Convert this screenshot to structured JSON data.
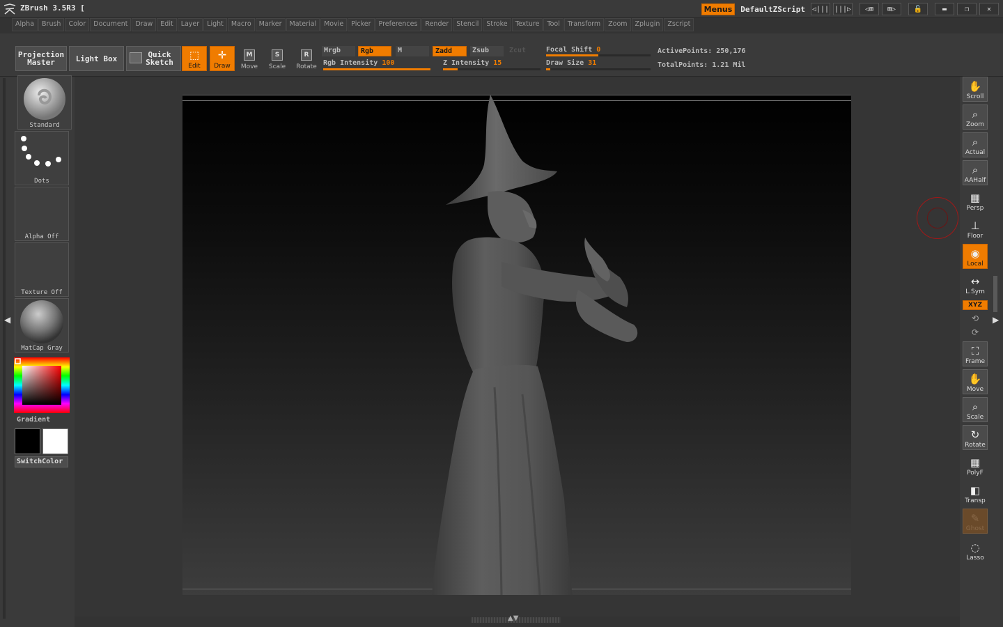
{
  "titlebar": {
    "app_title": "ZBrush 3.5R3 [",
    "menus_label": "Menus",
    "script_name": "DefaultZScript",
    "icons": [
      "step-back-icon",
      "step-forward-icon",
      "window-a-icon",
      "window-b-icon",
      "lock-icon",
      "minimize-icon",
      "restore-icon",
      "close-icon"
    ],
    "icon_glyphs": [
      "◁|||",
      "|||▷",
      "◁⊞",
      "⊞▷",
      "🔓",
      "▬",
      "❐",
      "✕"
    ]
  },
  "menubar": {
    "items": [
      "Alpha",
      "Brush",
      "Color",
      "Document",
      "Draw",
      "Edit",
      "Layer",
      "Light",
      "Macro",
      "Marker",
      "Material",
      "Movie",
      "Picker",
      "Preferences",
      "Render",
      "Stencil",
      "Stroke",
      "Texture",
      "Tool",
      "Transform",
      "Zoom",
      "Zplugin",
      "Zscript"
    ]
  },
  "shelf": {
    "projection_master": "Projection Master",
    "light_box": "Light Box",
    "quick_sketch": "Quick Sketch",
    "tools": {
      "edit": "Edit",
      "draw": "Draw",
      "move": "Move",
      "scale": "Scale",
      "rotate": "Rotate"
    },
    "modes": {
      "mrgb": "Mrgb",
      "rgb": "Rgb",
      "m": "M",
      "zadd": "Zadd",
      "zsub": "Zsub",
      "zcut": "Zcut"
    },
    "rgb_intensity": {
      "label": "Rgb Intensity",
      "value": "100",
      "fraction": 1.0
    },
    "z_intensity": {
      "label": "Z Intensity",
      "value": "15",
      "fraction": 0.15
    },
    "focal_shift": {
      "label": "Focal Shift",
      "value": "0",
      "fraction": 0.5
    },
    "draw_size": {
      "label": "Draw Size",
      "value": "31",
      "fraction": 0.04
    },
    "active_points": "ActivePoints: 250,176",
    "total_points": "TotalPoints: 1.21 Mil"
  },
  "left_tray": {
    "brush": "Standard",
    "stroke": "Dots",
    "alpha": "Alpha Off",
    "texture": "Texture Off",
    "material": "MatCap Gray",
    "gradient_label": "Gradient",
    "switch_color": "SwitchColor",
    "primary_color": "#000000",
    "secondary_color": "#ffffff"
  },
  "right_tray": {
    "scroll": "Scroll",
    "zoom": "Zoom",
    "actual": "Actual",
    "aahalf": "AAHalf",
    "persp": "Persp",
    "floor": "Floor",
    "local": "Local",
    "lsym": "L.Sym",
    "xyz": "XYZ",
    "frame": "Frame",
    "move": "Move",
    "scale": "Scale",
    "rotate": "Rotate",
    "polyf": "PolyF",
    "transp": "Transp",
    "ghost": "Ghost",
    "lasso": "Lasso"
  },
  "colors": {
    "accent": "#f07c00",
    "panel": "#3a3a3a",
    "button": "#4d4d4d"
  }
}
